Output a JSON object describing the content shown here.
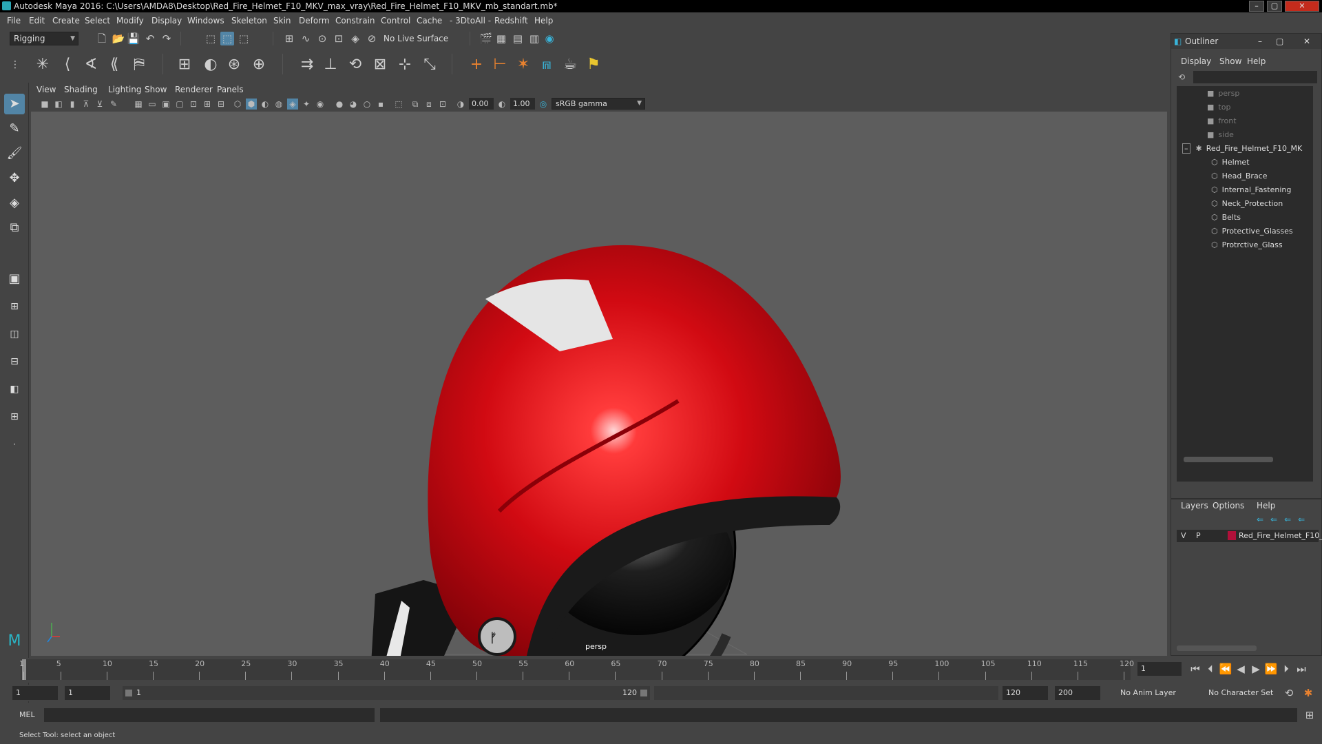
{
  "window": {
    "title": "Autodesk Maya 2016: C:\\Users\\AMDA8\\Desktop\\Red_Fire_Helmet_F10_MKV_max_vray\\Red_Fire_Helmet_F10_MKV_mb_standart.mb*",
    "minimize": "–",
    "maximize": "▢",
    "close": "✕"
  },
  "menu": [
    "File",
    "Edit",
    "Create",
    "Select",
    "Modify",
    "Display",
    "Windows",
    "Skeleton",
    "Skin",
    "Deform",
    "Constrain",
    "Control",
    "Cache",
    "- 3DtoAll -",
    "Redshift",
    "Help"
  ],
  "toolbar": {
    "menuset": "Rigging",
    "live_surface": "No Live Surface"
  },
  "viewport_menu": [
    "View",
    "Shading",
    "Lighting",
    "Show",
    "Renderer",
    "Panels"
  ],
  "viewport_tools": {
    "exposure": "0.00",
    "gamma": "1.00",
    "colorspace": "sRGB gamma"
  },
  "viewport": {
    "camera_label": "persp"
  },
  "outliner": {
    "title": "Outliner",
    "menu": [
      "Display",
      "Show",
      "Help"
    ],
    "cameras": [
      "persp",
      "top",
      "front",
      "side"
    ],
    "root": "Red_Fire_Helmet_F10_MK",
    "children": [
      "Helmet",
      "Head_Brace",
      "Internal_Fastening",
      "Neck_Protection",
      "Belts",
      "Protective_Glasses",
      "Protrctive_Glass"
    ]
  },
  "layers": {
    "menu": [
      "Layers",
      "Options",
      "Help"
    ],
    "visible": "V",
    "playback": "P",
    "layer_name": "Red_Fire_Helmet_F10_",
    "layer_color": "#b0103a"
  },
  "timeline": {
    "ticks": [
      "1",
      "5",
      "10",
      "15",
      "20",
      "25",
      "30",
      "35",
      "40",
      "45",
      "50",
      "55",
      "60",
      "65",
      "70",
      "75",
      "80",
      "85",
      "90",
      "95",
      "100",
      "105",
      "110",
      "115",
      "120"
    ],
    "current_frame": "1"
  },
  "range": {
    "start": "1",
    "playback_start": "1",
    "slider_start": "1",
    "slider_end": "120",
    "playback_end": "120",
    "end": "200",
    "anim_layer": "No Anim Layer",
    "char_set": "No Character Set"
  },
  "command": {
    "label": "MEL"
  },
  "helpline": "Select Tool: select an object",
  "colors": {
    "accent": "#5285a6",
    "helmet_red": "#d10a12"
  }
}
